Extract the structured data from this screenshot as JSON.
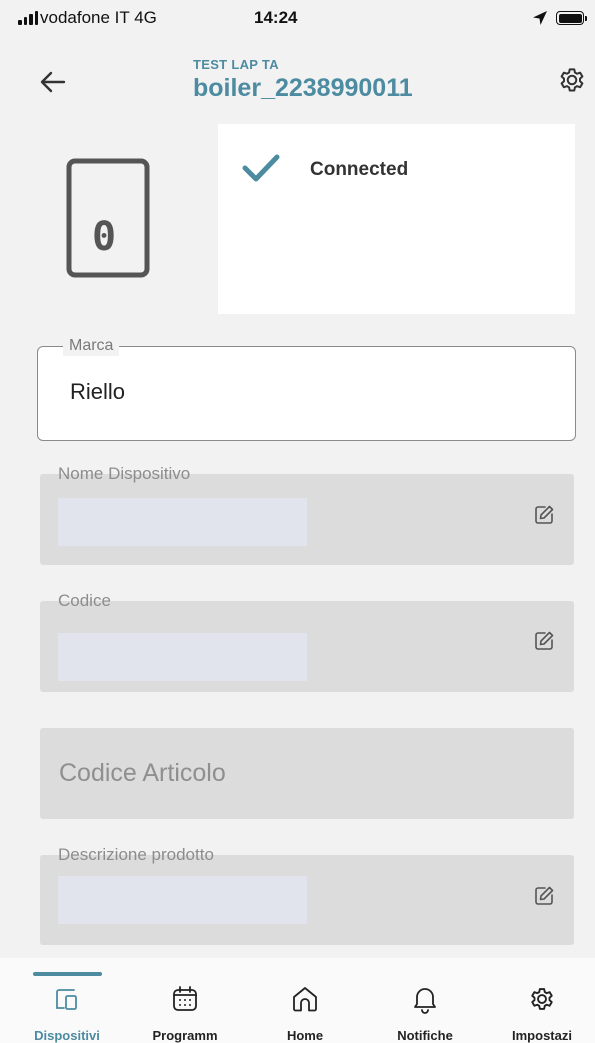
{
  "status_bar": {
    "carrier": "vodafone IT  4G",
    "time": "14:24"
  },
  "header": {
    "subtitle": "TEST LAP TA",
    "title": "boiler_2238990011",
    "back_icon": "arrow-left-icon",
    "settings_icon": "gear-icon"
  },
  "device": {
    "icon": "boiler-device-icon",
    "icon_text": "0",
    "status_icon": "check-icon",
    "status": "Connected"
  },
  "fields": {
    "marca": {
      "label": "Marca",
      "value": "Riello"
    },
    "nome_dispositivo": {
      "label": "Nome Dispositivo",
      "value": ""
    },
    "codice": {
      "label": "Codice",
      "value": ""
    },
    "codice_articolo": {
      "placeholder": "Codice Articolo"
    },
    "descrizione": {
      "label": "Descrizione prodotto",
      "value": ""
    }
  },
  "nav": {
    "items": [
      {
        "label": "Dispositivi",
        "icon": "devices-icon",
        "active": true
      },
      {
        "label": "Programm",
        "icon": "calendar-icon",
        "active": false
      },
      {
        "label": "Home",
        "icon": "home-icon",
        "active": false
      },
      {
        "label": "Notifiche",
        "icon": "bell-icon",
        "active": false
      },
      {
        "label": "Impostazi",
        "icon": "gear-icon",
        "active": false
      }
    ]
  },
  "colors": {
    "accent": "#4d8ba1",
    "background": "#f2f2f2",
    "field_grey": "#dcdcdc"
  }
}
